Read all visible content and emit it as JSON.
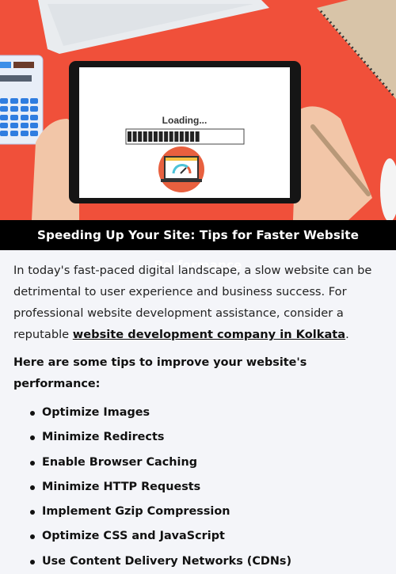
{
  "hero": {
    "screen_text": "Loading...",
    "progress_percent": 62,
    "colors": {
      "background": "#f0503a",
      "accent": "#e8603f"
    }
  },
  "banner": {
    "title": "Speeding Up Your Site: Tips for Faster Website Performance"
  },
  "intro": {
    "text_before": "In today's fast-paced digital landscape, a slow website can be detrimental to user experience and business success. For professional website development assistance, consider a reputable ",
    "link": "website development company in Kolkata",
    "text_after": "."
  },
  "tips": {
    "heading": "Here are some tips to improve your website's performance:",
    "items": [
      "Optimize Images",
      "Minimize Redirects",
      "Enable Browser Caching",
      "Minimize HTTP Requests",
      "Implement Gzip Compression",
      "Optimize CSS and JavaScript",
      "Use Content Delivery Networks (CDNs)"
    ]
  }
}
